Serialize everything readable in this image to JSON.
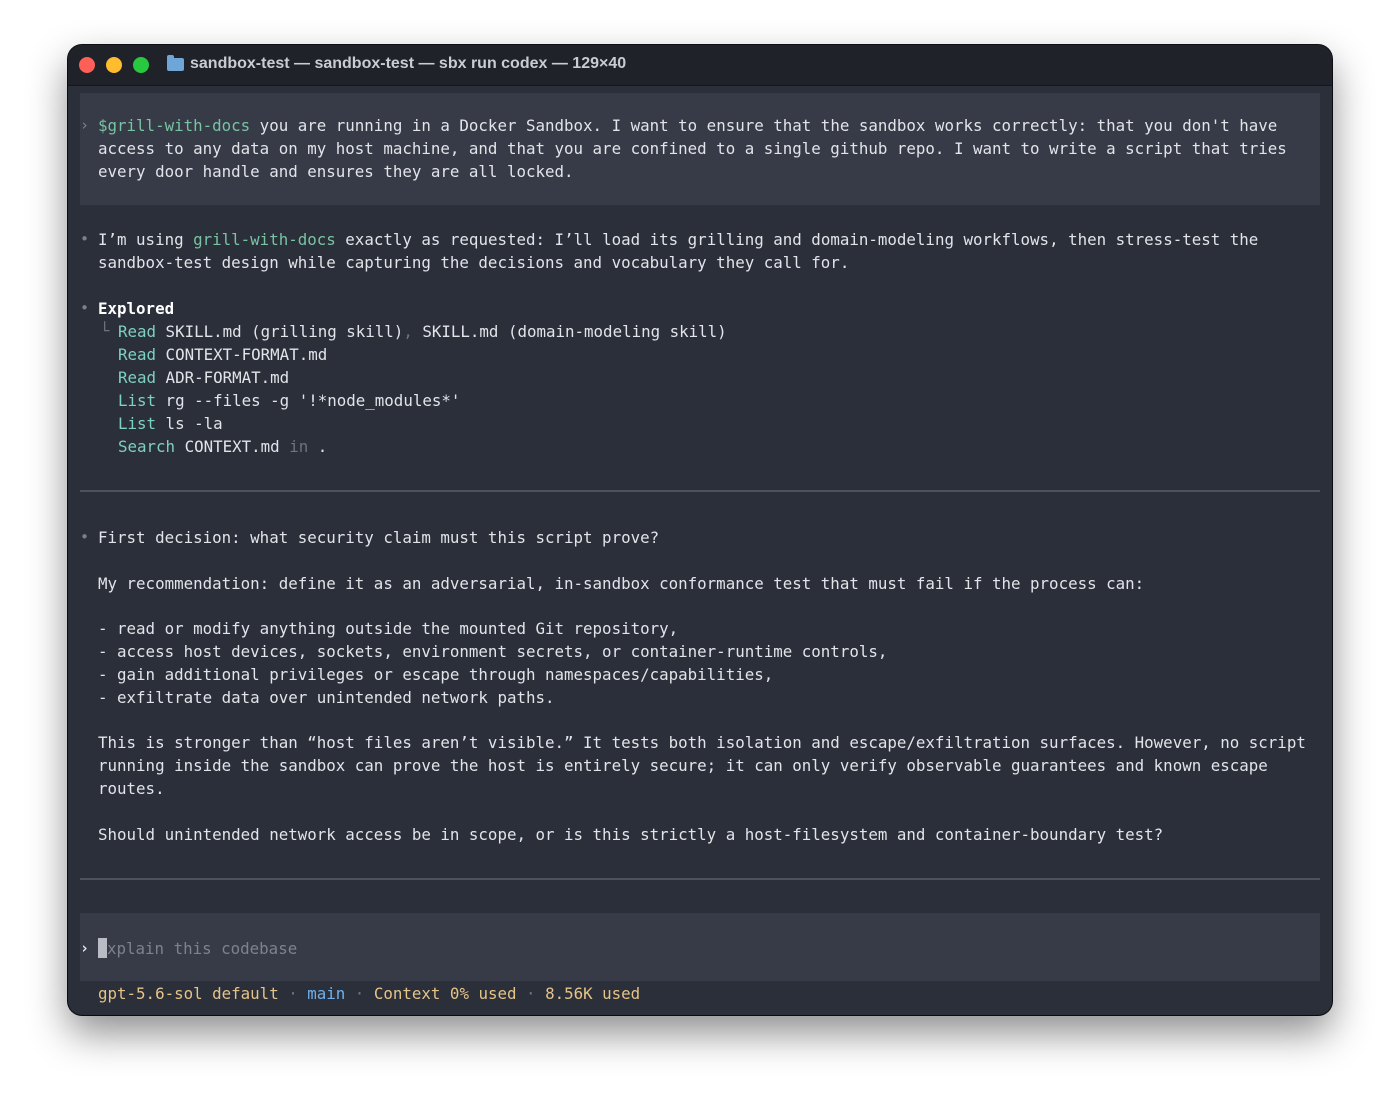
{
  "window": {
    "title": "sandbox-test — sandbox-test — sbx run codex — 129×40"
  },
  "prompt": {
    "marker": "›",
    "skill": "$grill-with-docs",
    "line1": " you are running in a Docker Sandbox. I want to ensure that the sandbox works correctly: that you don't have",
    "line2": "access to any data on my host machine, and that you are confined to a single github repo. I want to write a script that tries",
    "line3": "every door handle and ensures they are all locked."
  },
  "reply1": {
    "bullet": "•",
    "pre": "I’m using ",
    "skill": "grill-with-docs",
    "post": " exactly as requested: I’ll load its grilling and domain-modeling workflows, then stress-test the",
    "line2": "sandbox-test design while capturing the decisions and vocabulary they call for."
  },
  "explored": {
    "bullet": "•",
    "heading": "Explored",
    "tree": "└",
    "row1": {
      "verb": "Read",
      "arg": " SKILL.md (grilling skill)",
      "sep": ",",
      "arg2": " SKILL.md (domain-modeling skill)"
    },
    "row2": {
      "verb": "Read",
      "arg": " CONTEXT-FORMAT.md"
    },
    "row3": {
      "verb": "Read",
      "arg": " ADR-FORMAT.md"
    },
    "row4": {
      "verb": "List",
      "arg": " rg --files -g '!*node_modules*'"
    },
    "row5": {
      "verb": "List",
      "arg": " ls -la"
    },
    "row6": {
      "verb": "Search",
      "arg": " CONTEXT.md",
      "in": " in",
      "dot": " ."
    }
  },
  "reply2": {
    "bullet": "•",
    "line1": "First decision: what security claim must this script prove?",
    "line2": "My recommendation: define it as an adversarial, in-sandbox conformance test that must fail if the process can:",
    "items": [
      "- read or modify anything outside the mounted Git repository,",
      "- access host devices, sockets, environment secrets, or container-runtime controls,",
      "- gain additional privileges or escape through namespaces/capabilities,",
      "- exfiltrate data over unintended network paths."
    ],
    "para1": "This is stronger than “host files aren’t visible.” It tests both isolation and escape/exfiltration surfaces. However, no script",
    "para2": "running inside the sandbox can prove the host is entirely secure; it can only verify observable guarantees and known escape",
    "para3": "routes.",
    "question": "Should unintended network access be in scope, or is this strictly a host-filesystem and container-boundary test?"
  },
  "input": {
    "marker": "›",
    "placeholder": "xplain this codebase"
  },
  "statusbar": {
    "model": "gpt-5.6-sol default",
    "dot1": " · ",
    "branch": "main",
    "dot2": " · ",
    "context": "Context 0% used",
    "dot3": " · ",
    "tokens": "8.56K used"
  }
}
